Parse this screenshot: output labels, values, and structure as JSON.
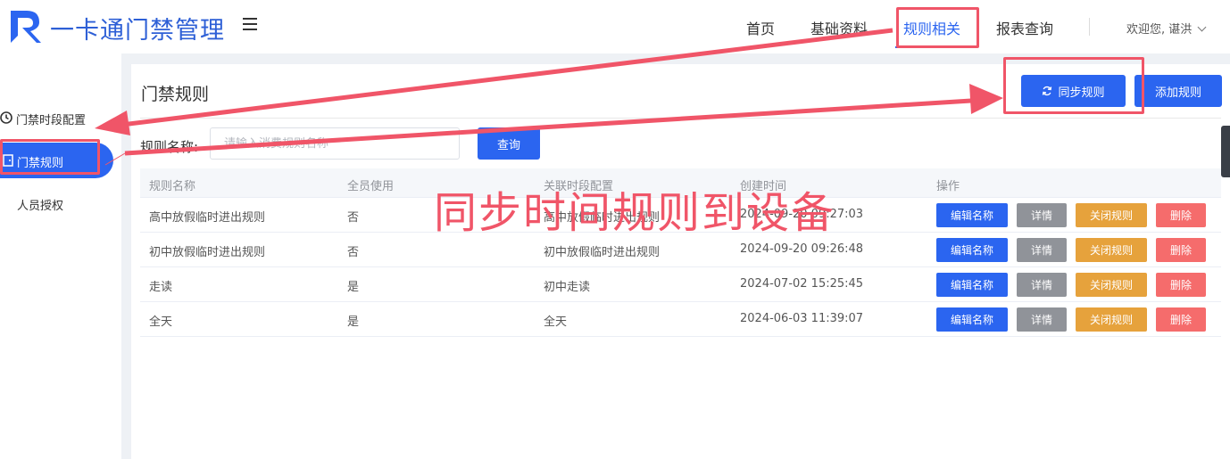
{
  "header": {
    "app_title": "一卡通门禁管理",
    "nav": [
      {
        "label": "首页"
      },
      {
        "label": "基础资料"
      },
      {
        "label": "规则相关",
        "active": true
      },
      {
        "label": "报表查询"
      }
    ],
    "user_greeting": "欢迎您, 谌洪"
  },
  "sidebar": {
    "items": [
      {
        "label": "门禁时段配置",
        "icon": "clock-icon"
      },
      {
        "label": "门禁规则",
        "icon": "door-icon",
        "active": true
      },
      {
        "label": "人员授权"
      }
    ]
  },
  "main": {
    "title": "门禁规则",
    "sync_button": "同步规则",
    "add_button": "添加规则",
    "filter": {
      "label": "规则名称:",
      "placeholder": "请输入消费规则名称",
      "value": "",
      "search_button": "查询"
    },
    "table": {
      "columns": [
        "规则名称",
        "全员使用",
        "关联时段配置",
        "创建时间",
        "操作"
      ],
      "rows": [
        {
          "name": "高中放假临时进出规则",
          "all_users": "否",
          "period": "高中放假临时进出规则",
          "created": "2024-09-20 09:27:03"
        },
        {
          "name": "初中放假临时进出规则",
          "all_users": "否",
          "period": "初中放假临时进出规则",
          "created": "2024-09-20 09:26:48"
        },
        {
          "name": "走读",
          "all_users": "是",
          "period": "初中走读",
          "created": "2024-07-02 15:25:45"
        },
        {
          "name": "全天",
          "all_users": "是",
          "period": "全天",
          "created": "2024-06-03 11:39:07"
        }
      ],
      "actions": {
        "edit": "编辑名称",
        "detail": "详情",
        "close": "关闭规则",
        "delete": "删除"
      }
    }
  },
  "annotation": {
    "text": "同步时间规则到设备",
    "color": "#f05568"
  },
  "colors": {
    "primary": "#2b65f0",
    "info": "#909399",
    "warning": "#e6a23c",
    "danger": "#f56c6c"
  }
}
